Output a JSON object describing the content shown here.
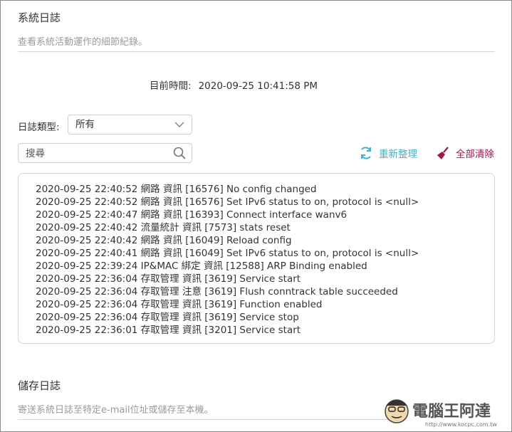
{
  "system_log": {
    "title": "系統日誌",
    "description": "查看系統活動運作的細節紀錄。"
  },
  "current_time": {
    "label": "目前時間:",
    "value": "2020-09-25 10:41:58 PM"
  },
  "filter": {
    "label": "日誌類型:",
    "selected": "所有"
  },
  "search": {
    "placeholder": "搜尋"
  },
  "actions": {
    "refresh_label": "重新整理",
    "clear_all_label": "全部清除",
    "refresh_color": "#3fb2c6",
    "clear_color": "#a2134c"
  },
  "logs": [
    "2020-09-25 22:40:52 網路 資訊 [16576] No config changed",
    "2020-09-25 22:40:52 網路 資訊 [16576] Set IPv6 status to on, protocol is <null>",
    "2020-09-25 22:40:47 網路 資訊 [16393] Connect interface wanv6",
    "2020-09-25 22:40:42 流量統計 資訊 [7573] stats reset",
    "2020-09-25 22:40:42 網路 資訊 [16049] Reload config",
    "2020-09-25 22:40:41 網路 資訊 [16049] Set IPv6 status to on, protocol is <null>",
    "2020-09-25 22:39:24 IP&MAC 綁定 資訊 [12588] ARP Binding enabled",
    "2020-09-25 22:36:04 存取管理 資訊 [3619] Service start",
    "2020-09-25 22:36:04 存取管理 注意 [3619] Flush conntrack table succeeded",
    "2020-09-25 22:36:04 存取管理 資訊 [3619] Function enabled",
    "2020-09-25 22:36:04 存取管理 資訊 [3619] Service stop",
    "2020-09-25 22:36:01 存取管理 資訊 [3201] Service start"
  ],
  "save_log": {
    "title": "儲存日誌",
    "description": "寄送系統日誌至特定e-mail位址或儲存至本機。"
  },
  "watermark": {
    "text": "電腦王阿達",
    "url": "http://www.kocpc.com.tw"
  }
}
